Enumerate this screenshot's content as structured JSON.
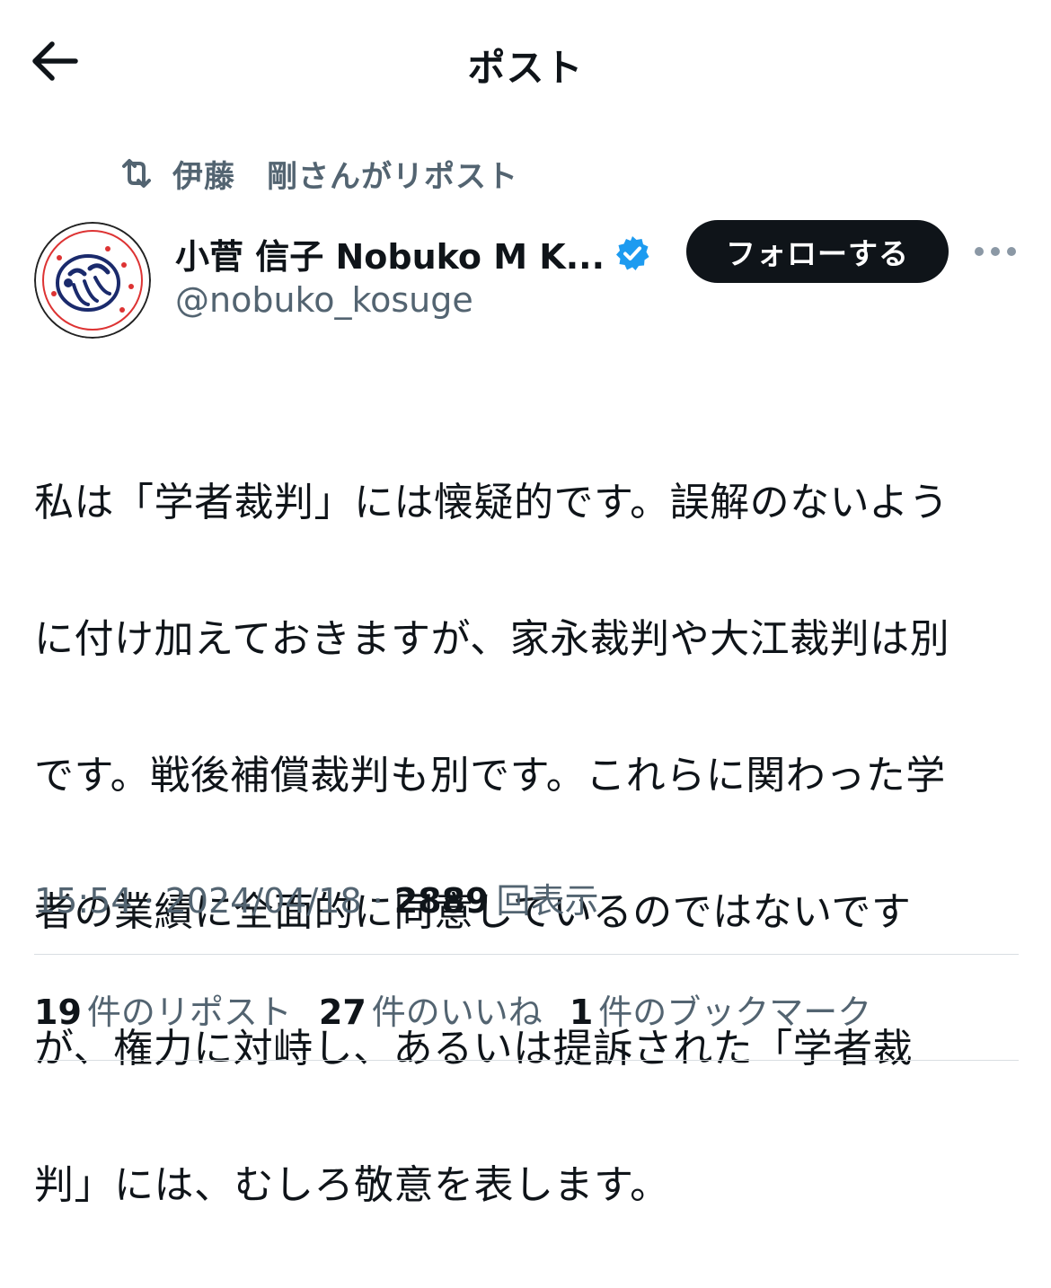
{
  "header": {
    "title": "ポスト",
    "back_icon": "arrow-left-icon"
  },
  "repost_context": {
    "icon": "repost-icon",
    "text": "伊藤　剛さんがリポスト"
  },
  "author": {
    "display_name": "小菅 信子 Nobuko M K...",
    "handle": "@nobuko_kosuge",
    "verified": true,
    "verified_color": "#1d9bf0"
  },
  "actions": {
    "follow_label": "フォローする",
    "more_icon": "more-horizontal-icon"
  },
  "post": {
    "lines": [
      "私は「学者裁判」には懐疑的です。誤解のないよう",
      "に付け加えておきますが、家永裁判や大江裁判は別",
      "です。戦後補償裁判も別です。これらに関わった学",
      "者の業績に全面的に同意しているのではないです",
      "が、権力に対峙し、あるいは提訴された「学者裁",
      "判」には、むしろ敬意を表します。"
    ]
  },
  "meta": {
    "time": "15:54",
    "date": "2024/04/18",
    "views_count": "2889",
    "views_label": "回表示",
    "separator": "·"
  },
  "stats": {
    "reposts_count": "19",
    "reposts_label": "件のリポスト",
    "likes_count": "27",
    "likes_label": "件のいいね",
    "bookmarks_count": "1",
    "bookmarks_label": "件のブックマーク"
  },
  "colors": {
    "text_primary": "#0f1419",
    "text_secondary": "#536471",
    "divider": "#d9dee2",
    "follow_bg": "#0f1419"
  }
}
